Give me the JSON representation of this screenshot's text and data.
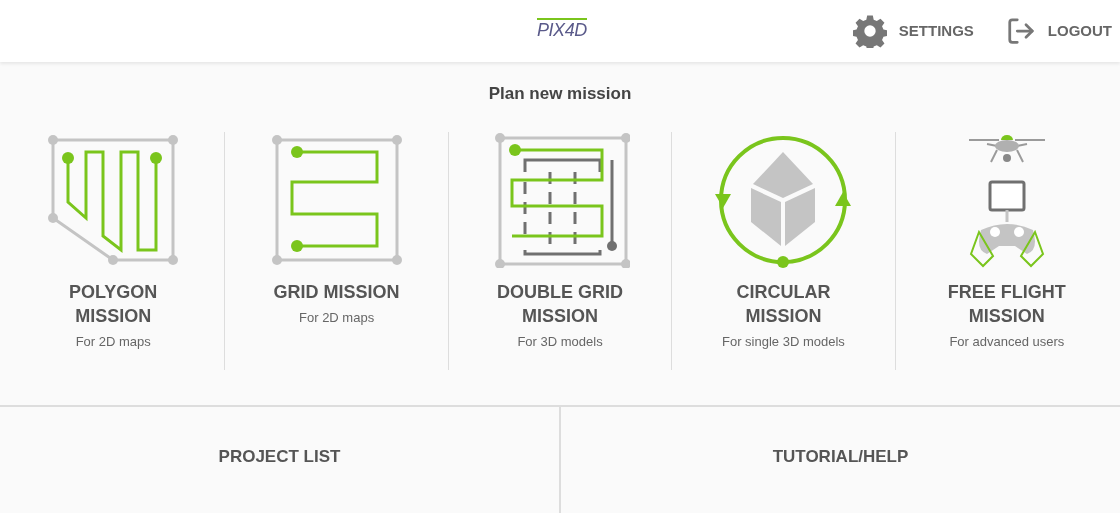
{
  "header": {
    "logo": "PIX4D",
    "actions": [
      {
        "kind": "settings",
        "label": "SETTINGS"
      },
      {
        "kind": "logout",
        "label": "LOGOUT"
      }
    ]
  },
  "section_title": "Plan new mission",
  "missions": [
    {
      "kind": "polygon",
      "title": "POLYGON MISSION",
      "subtitle": "For 2D maps"
    },
    {
      "kind": "grid",
      "title": "GRID MISSION",
      "subtitle": "For 2D maps"
    },
    {
      "kind": "double_grid",
      "title": "DOUBLE GRID MISSION",
      "subtitle": "For 3D models"
    },
    {
      "kind": "circular",
      "title": "CIRCULAR MISSION",
      "subtitle": "For single 3D models"
    },
    {
      "kind": "free_flight",
      "title": "FREE FLIGHT MISSION",
      "subtitle": "For advanced users"
    }
  ],
  "bottom_buttons": [
    "PROJECT LIST",
    "TUTORIAL/HELP"
  ]
}
